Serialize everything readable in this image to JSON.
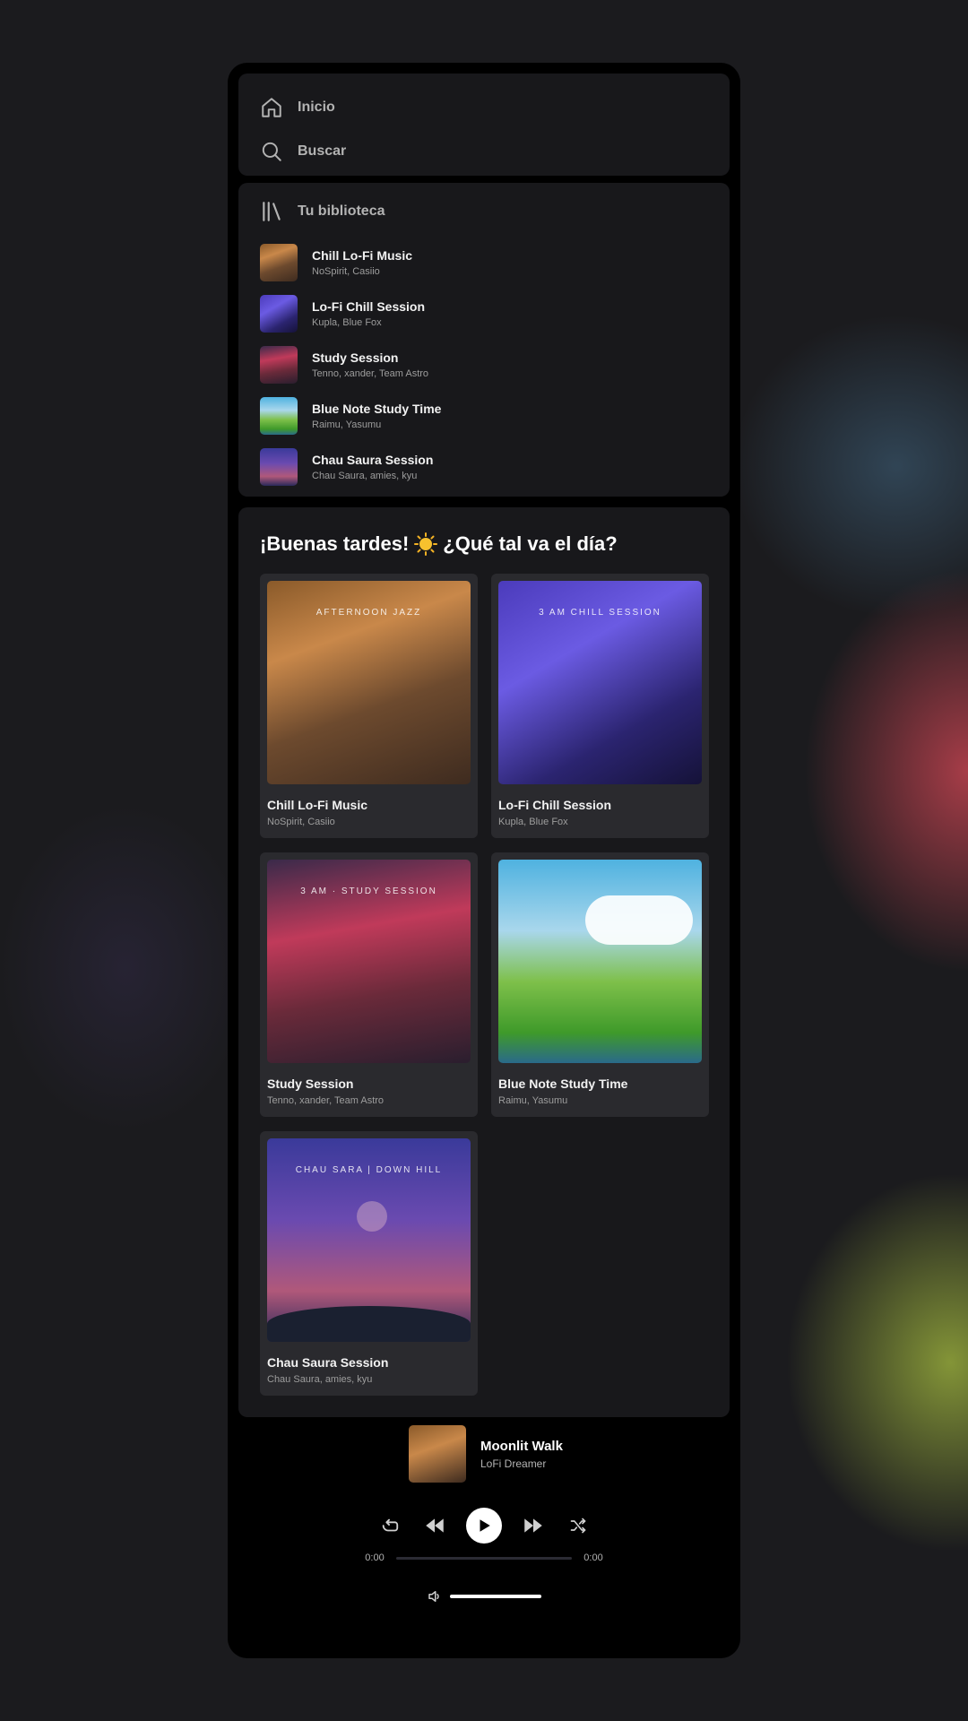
{
  "nav": {
    "home_label": "Inicio",
    "search_label": "Buscar"
  },
  "library": {
    "title": "Tu biblioteca",
    "items": [
      {
        "title": "Chill Lo-Fi Music",
        "subtitle": "NoSpirit, Casiio"
      },
      {
        "title": "Lo-Fi Chill Session",
        "subtitle": "Kupla, Blue Fox"
      },
      {
        "title": "Study Session",
        "subtitle": "Tenno, xander, Team Astro"
      },
      {
        "title": "Blue Note Study Time",
        "subtitle": "Raimu, Yasumu"
      },
      {
        "title": "Chau Saura Session",
        "subtitle": "Chau Saura, amies, kyu"
      }
    ]
  },
  "main": {
    "greeting_before": "¡Buenas tardes!",
    "greeting_after": "¿Qué tal va el día?",
    "cards": [
      {
        "title": "Chill Lo-Fi Music",
        "subtitle": "NoSpirit, Casiio",
        "cover_text": "AFTERNOON JAZZ"
      },
      {
        "title": "Lo-Fi Chill Session",
        "subtitle": "Kupla, Blue Fox",
        "cover_text": "3 AM CHILL SESSION"
      },
      {
        "title": "Study Session",
        "subtitle": "Tenno, xander, Team Astro",
        "cover_text": "3 AM · STUDY SESSION"
      },
      {
        "title": "Blue Note Study Time",
        "subtitle": "Raimu, Yasumu",
        "cover_text": ""
      },
      {
        "title": "Chau Saura Session",
        "subtitle": "Chau Saura, amies, kyu",
        "cover_text": "CHAU SARA | DOWN HILL"
      }
    ]
  },
  "player": {
    "track_title": "Moonlit Walk",
    "artist": "LoFi Dreamer",
    "elapsed": "0:00",
    "duration": "0:00",
    "progress": 0,
    "volume": 1
  },
  "colors": {
    "app_bg": "#000000",
    "panel_bg": "#18181b",
    "card_bg": "#2a2a2e",
    "text_secondary": "#b3b3b3"
  }
}
